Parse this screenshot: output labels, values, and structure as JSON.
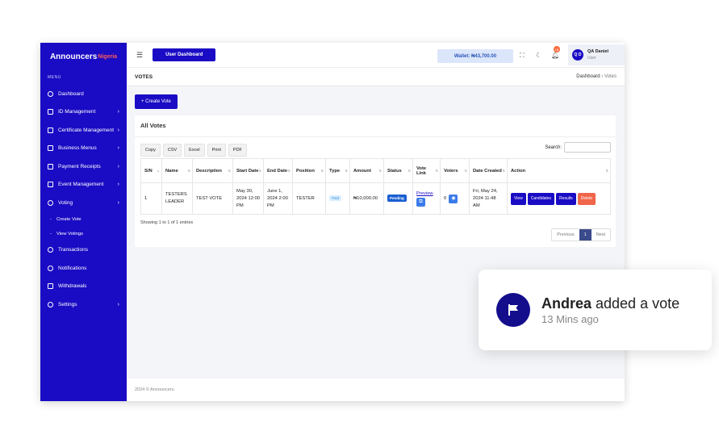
{
  "sidebar": {
    "logo": "Announcers",
    "logo_tag": "Nigeria",
    "menu_heading": "MENU",
    "items": [
      {
        "label": "Dashboard",
        "chev": ""
      },
      {
        "label": "ID Management",
        "chev": "›"
      },
      {
        "label": "Certificate Management",
        "chev": "›"
      },
      {
        "label": "Business Menus",
        "chev": "›"
      },
      {
        "label": "Payment Receipts",
        "chev": "›"
      },
      {
        "label": "Event Management",
        "chev": "›"
      },
      {
        "label": "Voting",
        "chev": "›"
      }
    ],
    "sub_items": [
      "Create Vote",
      "View Votings"
    ],
    "items_after": [
      {
        "label": "Transactions",
        "chev": ""
      },
      {
        "label": "Notifications",
        "chev": ""
      },
      {
        "label": "Withdrawals",
        "chev": ""
      },
      {
        "label": "Settings",
        "chev": "›"
      }
    ]
  },
  "topbar": {
    "dashboard_button": "User Dashboard",
    "wallet": "Wallet: ₦43,700.00",
    "notification_count": "18",
    "user_initials": "Q D",
    "user_name": "QA Daniel",
    "user_role": "User"
  },
  "page": {
    "title": "VOTES",
    "breadcrumb_root": "Dashboard",
    "breadcrumb_sep": "›",
    "breadcrumb_current": "Votes",
    "create_button": "+ Create Vote",
    "card_title": "All Votes",
    "export_buttons": [
      "Copy",
      "CSV",
      "Excel",
      "Print",
      "PDF"
    ],
    "search_label": "Search:"
  },
  "table": {
    "headers": [
      "S/N",
      "Name",
      "Description",
      "Start Date",
      "End Date",
      "Position",
      "Type",
      "Amount",
      "Status",
      "Vote Link",
      "Voters",
      "Date Created",
      "Action"
    ],
    "row": {
      "sn": "1",
      "name": "TESTERS LEADER",
      "description": "TEST VOTE",
      "start_date": "May 30, 2024 12:00 PM",
      "end_date": "June 1, 2024 2:00 PM",
      "position": "TESTER",
      "type": "Paid",
      "amount": "₦10,000.00",
      "status": "Pending",
      "vote_link": "Preview",
      "voters": "0",
      "date_created": "Fri, May 24, 2024 11:48 AM"
    },
    "actions": [
      "View",
      "Candidates",
      "Results",
      "Delete"
    ],
    "showing": "Showing 1 to 1 of 1 entries",
    "pager": {
      "previous": "Previous",
      "page": "1",
      "next": "Next"
    }
  },
  "footer": "2024 © Announcers.",
  "toast": {
    "name": "Andrea",
    "action": " added a vote",
    "time": "13 Mins ago"
  },
  "colors": {
    "brand": "#1a0bc4",
    "danger": "#f0664a",
    "pending": "#1a5fd1"
  }
}
